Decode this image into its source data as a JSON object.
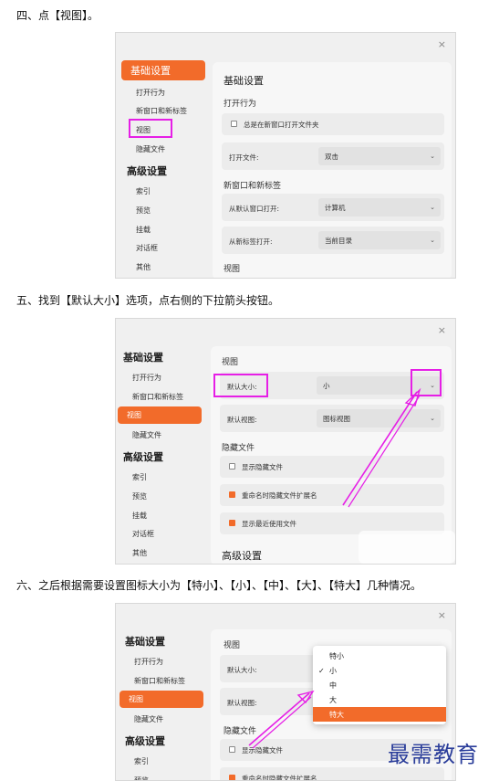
{
  "steps": {
    "s4": "四、点【视图】。",
    "s5": "五、找到【默认大小】选项，点右侧的下拉箭头按钮。",
    "s6": "六、之后根据需要设置图标大小为【特小】、【小】、【中】、【大】、【特大】几种情况。"
  },
  "close_glyph": "×",
  "sidebar": {
    "basic_heading": "基础设置",
    "items_basic": [
      "打开行为",
      "新窗口和新标签",
      "视图",
      "隐藏文件"
    ],
    "advanced_heading": "高级设置",
    "items_advanced": [
      "索引",
      "预览",
      "挂载",
      "对话框",
      "其他"
    ]
  },
  "shot1": {
    "panel_title": "基础设置",
    "open_behavior": "打开行为",
    "always_new_window": "总是在新窗口打开文件夹",
    "open_file_label": "打开文件:",
    "open_file_value": "双击",
    "new_window_section": "新窗口和新标签",
    "from_default_window_label": "从默认窗口打开:",
    "from_default_window_value": "计算机",
    "from_new_tab_label": "从新标签打开:",
    "from_new_tab_value": "当前目录",
    "view_section": "视图"
  },
  "shot2": {
    "view_section": "视图",
    "default_size_label": "默认大小:",
    "default_size_value": "小",
    "default_view_label": "默认视图:",
    "default_view_value": "图标视图",
    "hidden_files_section": "隐藏文件",
    "show_hidden": "显示隐藏文件",
    "hide_ext_on_rename": "重命名时隐藏文件扩展名",
    "show_recent": "显示最近使用文件",
    "advanced_partial": "高级设置"
  },
  "shot3": {
    "view_section": "视图",
    "default_size_label": "默认大小:",
    "default_view_label": "默认视图:",
    "hidden_files_section": "隐藏文件",
    "show_hidden": "显示隐藏文件",
    "hide_ext_on_rename": "重命名时隐藏文件扩展名",
    "dropdown_options": [
      "特小",
      "小",
      "中",
      "大",
      "特大"
    ],
    "check_glyph": "✓"
  },
  "chevron_glyph": "⌄",
  "watermark": "最需教育",
  "colors": {
    "accent": "#f26b2a",
    "highlight": "#e61fe6",
    "watermark": "#2a3d9a"
  }
}
